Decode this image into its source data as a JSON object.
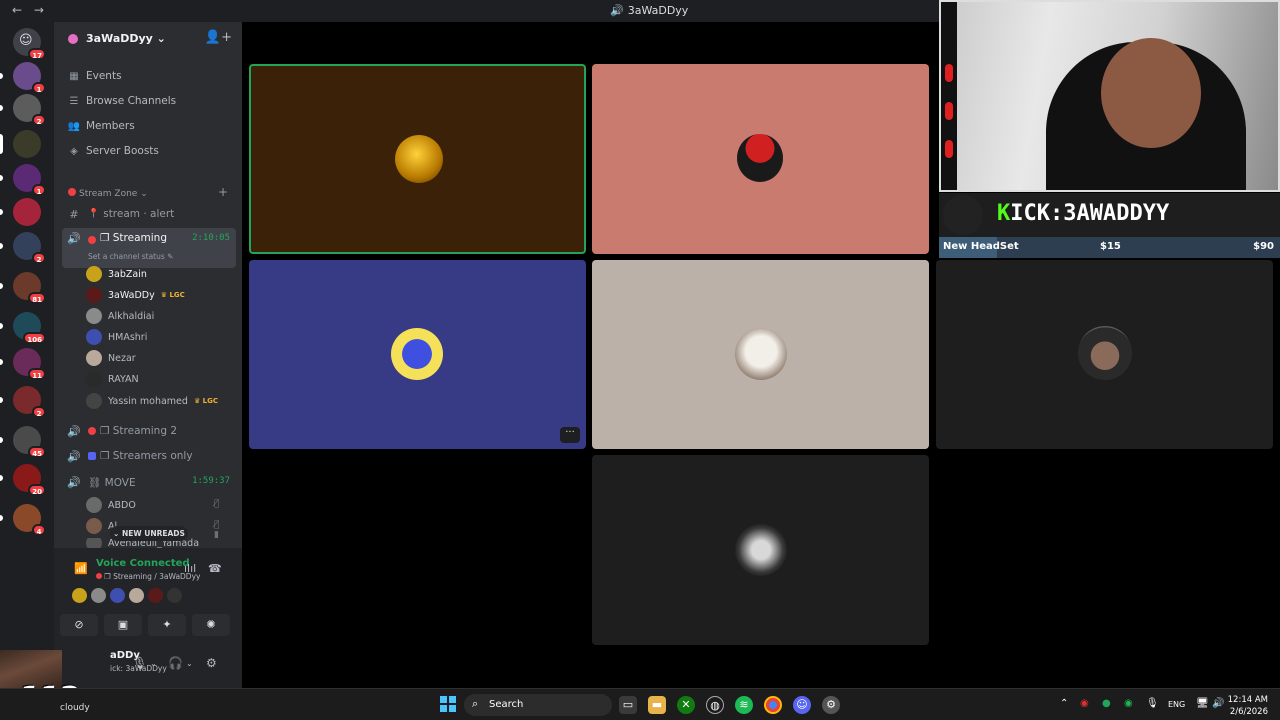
{
  "window": {
    "title": "3aWaDDyy",
    "back": "←",
    "forward": "→"
  },
  "server": {
    "name": "3aWaDDyy ⌄"
  },
  "rail_badges": [
    "17",
    "1",
    "2",
    "1",
    "2",
    "81",
    "106",
    "11",
    "2",
    "45",
    "20",
    "4"
  ],
  "menu": [
    {
      "icon": "▦",
      "label": "Events"
    },
    {
      "icon": "☰",
      "label": "Browse Channels"
    },
    {
      "icon": "👥",
      "label": "Members"
    },
    {
      "icon": "◈",
      "label": "Server Boosts"
    }
  ],
  "category": {
    "label": "Stream Zone ⌄",
    "plus": "+"
  },
  "channels": {
    "alert": "stream ‧ alert",
    "streaming": {
      "label": "❐ Streaming",
      "timer": "2:10:05",
      "status": "Set a channel status ✎"
    },
    "streaming2": "❐ Streaming 2",
    "streamers_only": "❐ Streamers only",
    "move": {
      "label": "⛓ MOVE",
      "timer": "1:59:37"
    }
  },
  "voice_users": [
    {
      "name": "3abZain",
      "tag": ""
    },
    {
      "name": "3aWaDDy",
      "tag": "LGC"
    },
    {
      "name": "Alkhaldiai",
      "tag": ""
    },
    {
      "name": "HMAshri",
      "tag": ""
    },
    {
      "name": "Nezar",
      "tag": ""
    },
    {
      "name": "RAYAN",
      "tag": ""
    },
    {
      "name": "Yassin mohamed",
      "tag": "LGC"
    }
  ],
  "move_users": [
    {
      "name": "ABDO"
    },
    {
      "name": "Al..."
    },
    {
      "name": "Avenaleuil_Yamada"
    }
  ],
  "new_unreads": "⌄ NEW UNREADS",
  "voice_panel": {
    "title": "Voice Connected",
    "subtitle": "❐ Streaming / 3aWaDDyy"
  },
  "user": {
    "name": "aDDy",
    "status": "ick: 3aWaDDyy"
  },
  "overlay": {
    "multiplier": "x112",
    "weather": "cloudy"
  },
  "kick": {
    "prefix": "K",
    "text": "ICK:3AWADDYY"
  },
  "goal": {
    "label": "New HeadSet",
    "current": "$15",
    "target": "$90",
    "progress": 0.17
  },
  "taskbar": {
    "search": "Search",
    "lang": "ENG",
    "time": "12:14 AM",
    "date": "2/6/2026"
  },
  "colors": {
    "accent_green": "#23a559",
    "tile1": "#3a2108",
    "tile2": "#c87b6e",
    "tile3": "#373a85",
    "tile4": "#bcb1a9",
    "tile_dark": "#1e1e1e"
  }
}
